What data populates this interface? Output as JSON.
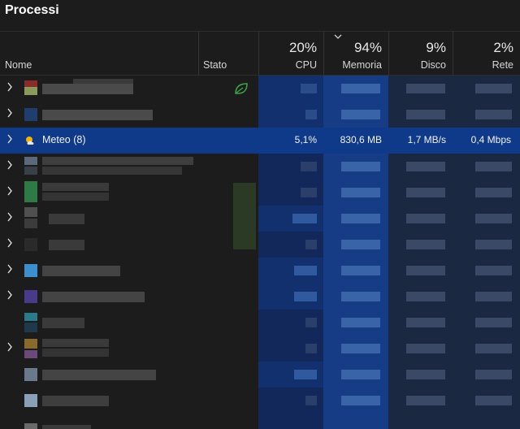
{
  "window": {
    "title": "Processi"
  },
  "header": {
    "columns": {
      "name": "Nome",
      "status": "Stato",
      "cpu": {
        "percent": "20%",
        "label": "CPU"
      },
      "memory": {
        "percent": "94%",
        "label": "Memoria"
      },
      "disk": {
        "percent": "9%",
        "label": "Disco"
      },
      "network": {
        "percent": "2%",
        "label": "Rete"
      }
    },
    "sort_icon": "chevron-down-icon"
  },
  "rows": {
    "meteo": {
      "name": "Meteo (8)",
      "icon": "weather-icon",
      "cpu": "5,1%",
      "memory": "830,6 MB",
      "disk": "1,7 MB/s",
      "network": "0,4 Mbps"
    },
    "first_row_status_icon": "efficiency-mode-leaf-icon"
  },
  "colors": {
    "background": "#1c1c1c",
    "highlight_row": "#0f3a8a",
    "cpu_heat": "#12306e",
    "memory_heat": "#163c86",
    "efficiency_leaf": "#3ca844"
  }
}
